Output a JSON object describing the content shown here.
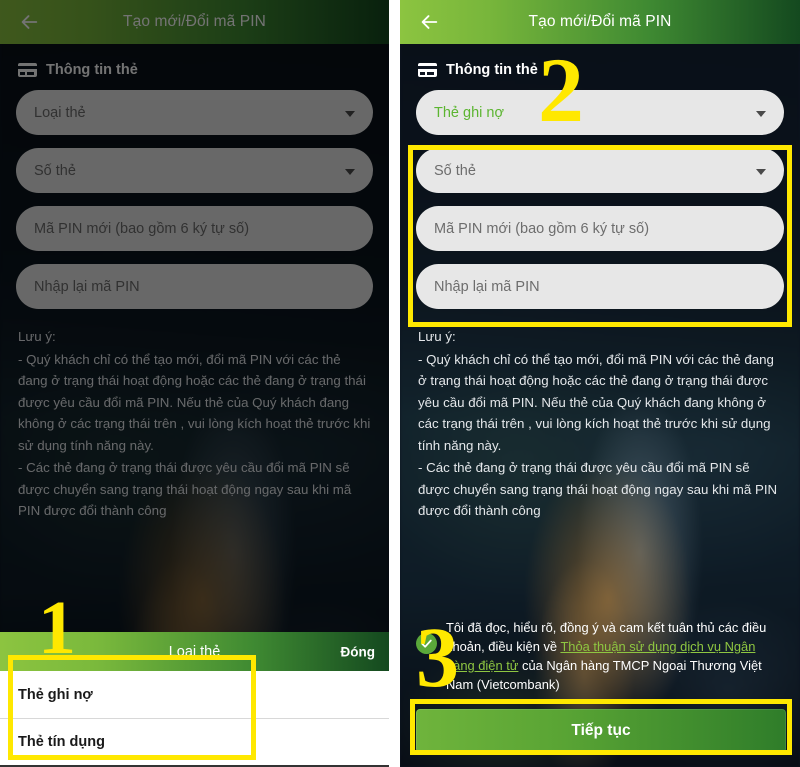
{
  "header": {
    "title": "Tạo mới/Đổi mã PIN",
    "back_icon": "arrow-left-icon"
  },
  "section": {
    "icon": "credit-card-icon",
    "label": "Thông tin thẻ"
  },
  "left_screen": {
    "fields": [
      {
        "placeholder": "Loại thẻ",
        "type": "select",
        "value": "",
        "caret": true
      },
      {
        "placeholder": "Số thẻ",
        "type": "select",
        "value": "",
        "caret": true
      },
      {
        "placeholder": "Mã PIN mới (bao gồm 6 ký tự số)",
        "type": "text",
        "value": "",
        "caret": false
      },
      {
        "placeholder": "Nhập lại mã PIN",
        "type": "text",
        "value": "",
        "caret": false
      }
    ],
    "sheet": {
      "title": "Loại thẻ",
      "close_label": "Đóng",
      "options": [
        "Thẻ ghi nợ",
        "Thẻ tín dụng"
      ]
    },
    "annotation_number": "1"
  },
  "right_screen": {
    "fields": [
      {
        "placeholder": "Loại thẻ",
        "type": "select",
        "value": "Thẻ ghi nợ",
        "caret": true
      },
      {
        "placeholder": "Số thẻ",
        "type": "select",
        "value": "",
        "caret": true
      },
      {
        "placeholder": "Mã PIN mới (bao gồm 6 ký tự số)",
        "type": "text",
        "value": "",
        "caret": false
      },
      {
        "placeholder": "Nhập lại mã PIN",
        "type": "text",
        "value": "",
        "caret": false
      }
    ],
    "terms": {
      "checkbox_icon": "check-circle-icon",
      "checked": true,
      "text_before": "Tôi đã đọc, hiểu rõ, đồng ý và cam kết tuân thủ các điều khoản, điều kiện về ",
      "link_text": "Thỏa thuận sử dụng dịch vụ Ngân hàng điện tử",
      "text_after": " của Ngân hàng TMCP Ngoại Thương Việt Nam (Vietcombank)"
    },
    "cta_label": "Tiếp tục",
    "annotation_number_fields": "2",
    "annotation_number_terms": "3"
  },
  "note": {
    "heading": "Lưu ý:",
    "lines": [
      "- Quý khách chỉ có thể tạo mới, đổi mã PIN với các thẻ đang ở trạng thái hoạt động hoặc các thẻ đang ở trạng thái được yêu cầu đổi mã PIN. Nếu thẻ của Quý khách đang không ở các trạng thái trên , vui lòng kích hoạt thẻ trước khi sử dụng tính năng này.",
      "- Các thẻ đang ở trạng thái được yêu cầu đổi mã PIN sẽ được chuyển sang trạng thái hoạt động ngay sau khi mã PIN được đổi thành công"
    ]
  },
  "colors": {
    "header_green_light": "#8cc440",
    "header_green_dark": "#14491f",
    "accent_green": "#5cb531",
    "annotation_yellow": "#ffe800",
    "field_gray": "#e7e7e7",
    "background_dark": "#0d1420"
  }
}
